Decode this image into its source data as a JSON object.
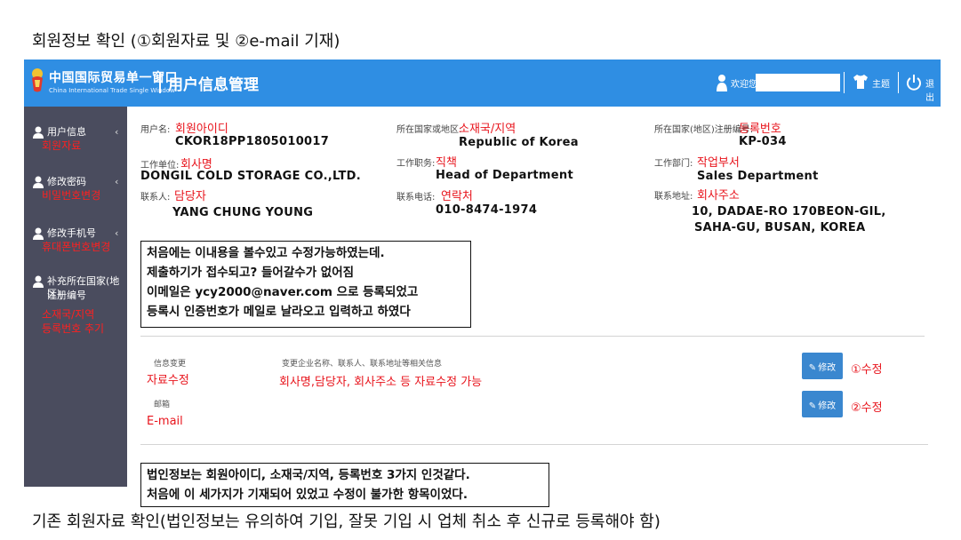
{
  "doc": {
    "heading": "회원정보 확인 (①회원자료 및 ②e-mail 기재)",
    "footer": "기존 회원자료 확인(법인정보는 유의하여  기입, 잘못 기입 시 업체 취소 후 신규로 등록해야 함)"
  },
  "header": {
    "logo_cn": "中国国际贸易单一窗口",
    "logo_en": "China International Trade Single Window",
    "module_title": "用户信息管理",
    "welcome": "欢迎您,",
    "welcome_value": "",
    "theme": "主题",
    "logout": "退出",
    "icons": [
      "user-icon",
      "shirt-icon",
      "power-icon"
    ]
  },
  "sidebar": {
    "items": [
      {
        "label": "用户信息",
        "note": "회원자료"
      },
      {
        "label": "修改密码",
        "note": "비밀번호변경"
      },
      {
        "label": "修改手机号",
        "note": "휴대폰번호변경"
      },
      {
        "label": "补充所在国家(地区)",
        "label2": "注册编号",
        "note": "소재국/지역",
        "note2": "등록번호 추기"
      }
    ]
  },
  "info": {
    "username": {
      "label": "用户名:",
      "note": "회원아이디",
      "value": "CKOR18PP1805010017"
    },
    "country": {
      "label": "所在国家或地区:",
      "note": "소재국/지역",
      "value": "Republic of Korea"
    },
    "reg_no": {
      "label": "所在国家(地区)注册编号:",
      "note": "등록번호",
      "value": "KP-034"
    },
    "company": {
      "label": "工作单位:",
      "note": "회사명",
      "value": "DONGIL COLD STORAGE CO.,LTD."
    },
    "position": {
      "label": "工作职务:",
      "note": "직책",
      "value": "Head of Department"
    },
    "department": {
      "label": "工作部门:",
      "note": "작업부서",
      "value": "Sales Department"
    },
    "contact": {
      "label": "联系人:",
      "note": "담당자",
      "value": "YANG CHUNG YOUNG"
    },
    "phone": {
      "label": "联系电话:",
      "note": "연락처",
      "value": "010-8474-1974"
    },
    "address": {
      "label": "联系地址:",
      "note": "회사주소",
      "value": "10, DADAE-RO 170BEON-GIL,",
      "value2": "SAHA-GU, BUSAN, KOREA"
    }
  },
  "note_box_1": [
    "처음에는 이내용을 볼수있고 수정가능하였는데.",
    "제출하기가 접수되고? 들어갈수가 없어짐",
    "이메일은 ycy2000@naver.com 으로 등록되었고",
    "등록시 인증번호가 메일로 날라오고 입력하고 하였다"
  ],
  "change": {
    "info_label": "信息变更",
    "info_note": "자료수정",
    "info_desc": "变更企业名称、联系人、联系地址等相关信息",
    "info_desc_note": "회사명,담당자, 회사주소 등 자료수정 가능",
    "email_label": "邮箱",
    "email_note": "E-mail",
    "edit_button": "修改",
    "mod_note_1": "①수정",
    "mod_note_2": "②수정"
  },
  "note_box_2": [
    "법인정보는 회원아이디, 소재국/지역, 등록번호 3가지 인것같다.",
    "처음에 이 세가지가 기재되어 있었고 수정이 불가한 항목이었다."
  ],
  "colors": {
    "topbar": "#2f8ee3",
    "sidebar": "#4a4c5e",
    "annotation_red": "#e8141c",
    "button": "#3a87cf"
  }
}
